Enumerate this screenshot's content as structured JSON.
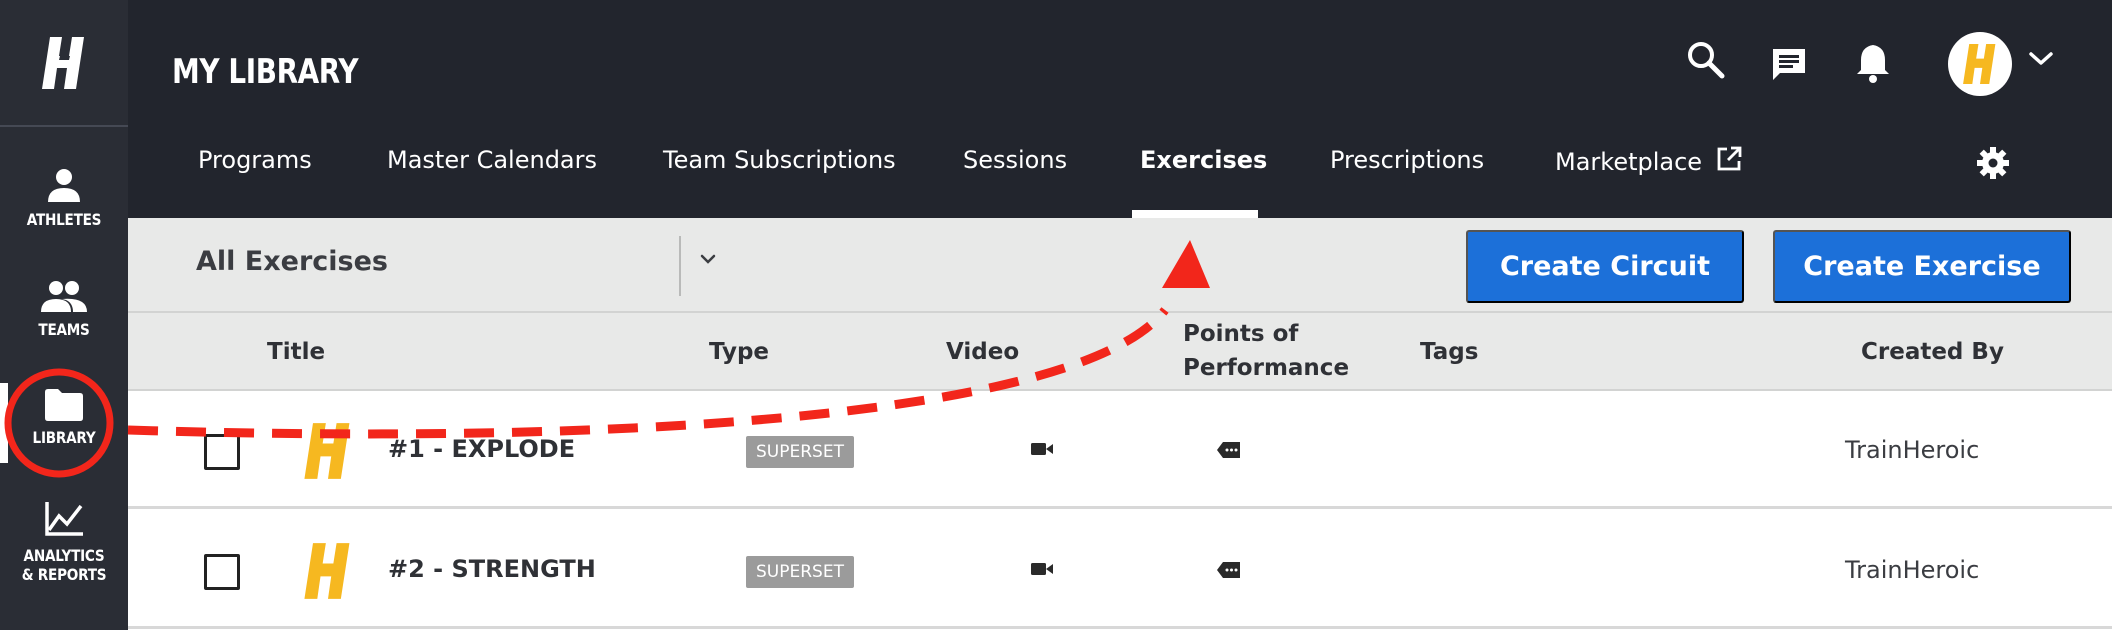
{
  "sidebar": {
    "items": [
      {
        "label": "ATHLETES",
        "icon": "person-icon"
      },
      {
        "label": "TEAMS",
        "icon": "group-icon"
      },
      {
        "label": "LIBRARY",
        "icon": "folder-icon"
      },
      {
        "label_line1": "ANALYTICS",
        "label_line2": "& REPORTS",
        "icon": "chart-line-icon"
      }
    ]
  },
  "header": {
    "title": "MY LIBRARY"
  },
  "tabs": [
    {
      "label": "Programs"
    },
    {
      "label": "Master Calendars"
    },
    {
      "label": "Team Subscriptions"
    },
    {
      "label": "Sessions"
    },
    {
      "label": "Exercises",
      "active": true
    },
    {
      "label": "Prescriptions"
    },
    {
      "label": "Marketplace"
    }
  ],
  "toolbar": {
    "filter_value": "All Exercises",
    "create_circuit_label": "Create Circuit",
    "create_exercise_label": "Create Exercise"
  },
  "table": {
    "columns": {
      "title": "Title",
      "type": "Type",
      "video": "Video",
      "pop_line1": "Points of",
      "pop_line2": "Performance",
      "tags": "Tags",
      "created_by": "Created By"
    },
    "rows": [
      {
        "title": "#1 - EXPLODE",
        "type": "SUPERSET",
        "created_by": "TrainHeroic"
      },
      {
        "title": "#2 - STRENGTH",
        "type": "SUPERSET",
        "created_by": "TrainHeroic"
      }
    ]
  },
  "colors": {
    "sidebar_bg": "#2a2d35",
    "header_bg": "#22252d",
    "accent_blue": "#1c70d9",
    "brand_yellow": "#f6b820",
    "annotation_red": "#f2261b"
  }
}
